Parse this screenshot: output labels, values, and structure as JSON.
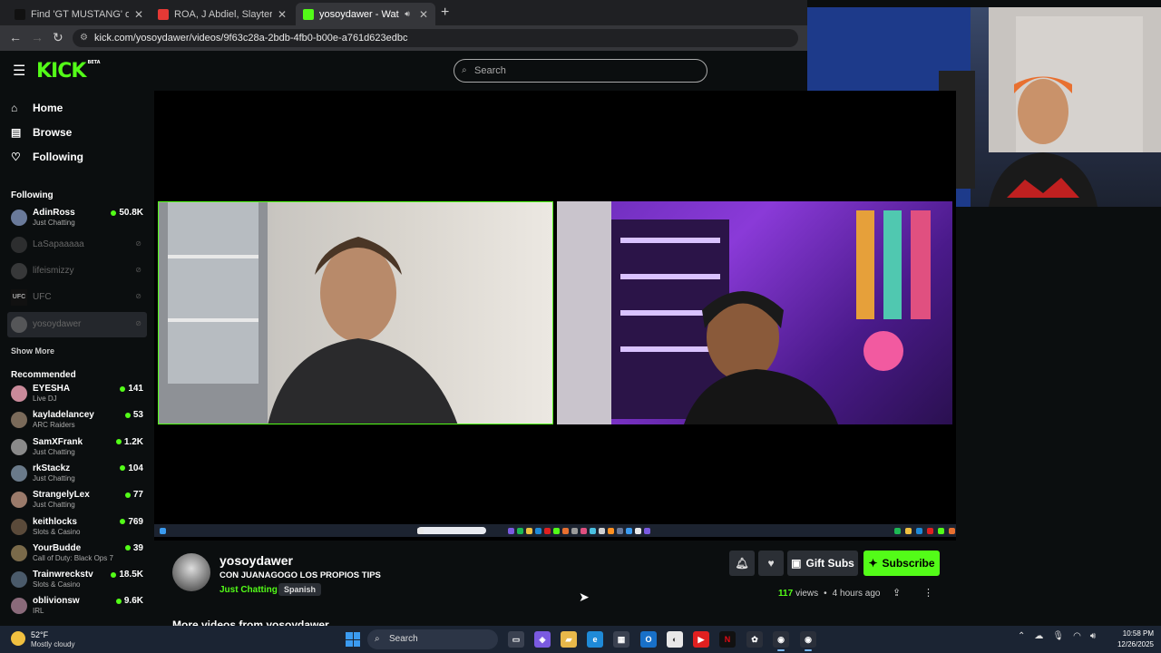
{
  "browser": {
    "tabs": [
      {
        "title": "Find 'GT MUSTANG' on TikTok |",
        "favicon_color": "#111111",
        "active": false
      },
      {
        "title": "ROA, J Abdiel, Slayter - ECLIPSE",
        "favicon_color": "#e53935",
        "active": false
      },
      {
        "title": "yosoydawer - Watch the VC",
        "favicon_color": "#53fc18",
        "active": true
      }
    ],
    "url": "kick.com/yosoydawer/videos/9f63c28a-2bdb-4fb0-b00e-a761d623edbc"
  },
  "kick": {
    "logo": "KICK",
    "logo_badge": "BETA",
    "search_placeholder": "Search",
    "accent_color": "#53fc18"
  },
  "sidebar": {
    "nav": [
      {
        "label": "Home",
        "icon": "home-icon"
      },
      {
        "label": "Browse",
        "icon": "browse-icon"
      },
      {
        "label": "Following",
        "icon": "heart-icon"
      }
    ],
    "following_title": "Following",
    "following": [
      {
        "name": "AdinRoss",
        "category": "Just Chatting",
        "viewers": "50.8K",
        "live": true
      },
      {
        "name": "LaSapaaaaa",
        "live": false
      },
      {
        "name": "lifeismizzy",
        "live": false
      },
      {
        "name": "UFC",
        "live": false
      },
      {
        "name": "yosoydawer",
        "live": false,
        "selected": true
      }
    ],
    "show_more": "Show More",
    "recommended_title": "Recommended",
    "recommended": [
      {
        "name": "EYESHA",
        "category": "Live DJ",
        "viewers": "141"
      },
      {
        "name": "kayladelancey",
        "category": "ARC Raiders",
        "viewers": "53"
      },
      {
        "name": "SamXFrank",
        "category": "Just Chatting",
        "viewers": "1.2K"
      },
      {
        "name": "rkStackz",
        "category": "Just Chatting",
        "viewers": "104"
      },
      {
        "name": "StrangelyLex",
        "category": "Just Chatting",
        "viewers": "77"
      },
      {
        "name": "keithlocks",
        "category": "Slots & Casino",
        "viewers": "769"
      },
      {
        "name": "YourBudde",
        "category": "Call of Duty: Black Ops 7",
        "viewers": "39"
      },
      {
        "name": "Trainwreckstv",
        "category": "Slots & Casino",
        "viewers": "18.5K"
      },
      {
        "name": "oblivionsw",
        "category": "IRL",
        "viewers": "9.6K"
      }
    ]
  },
  "stream": {
    "channel": "yosoydawer",
    "title": "CON JUANAGOGO LOS PROPIOS TIPS",
    "category": "Just Chatting",
    "language": "Spanish",
    "views": "117",
    "views_label": "views",
    "age": "4 hours ago",
    "gift_label": "Gift Subs",
    "subscribe_label": "Subscribe",
    "more_videos": "More videos from yosoydawer"
  },
  "taskbar": {
    "temp": "52°F",
    "weather": "Mostly cloudy",
    "search_label": "Search",
    "time": "10:58 PM",
    "date": "12/26/2025"
  }
}
